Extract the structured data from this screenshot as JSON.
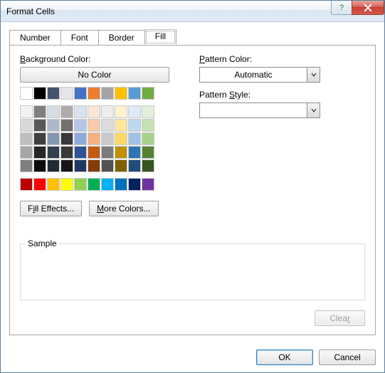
{
  "window": {
    "title": "Format Cells"
  },
  "tabs": [
    "Number",
    "Font",
    "Border",
    "Fill"
  ],
  "active_tab": "Fill",
  "labels": {
    "background_color": "Background Color:",
    "pattern_color": "Pattern Color:",
    "pattern_style": "Pattern Style:",
    "sample": "Sample"
  },
  "buttons": {
    "no_color": "No Color",
    "fill_effects_pre": "F",
    "fill_effects_ul": "i",
    "fill_effects_post": "ll Effects...",
    "more_colors_pre": "",
    "more_colors_ul": "M",
    "more_colors_post": "ore Colors...",
    "clear": "Clear",
    "ok": "OK",
    "cancel": "Cancel"
  },
  "pattern_color_value": "Automatic",
  "pattern_style_value": "",
  "theme_colors_row1": [
    "#FFFFFF",
    "#000000",
    "#44546A",
    "#E7E6E6",
    "#4472C4",
    "#ED7D31",
    "#A5A5A5",
    "#FFC000",
    "#5B9BD5",
    "#70AD47"
  ],
  "theme_shades": [
    [
      "#F2F2F2",
      "#808080",
      "#D6DCE4",
      "#AEABAB",
      "#D9E2F3",
      "#FCE4D6",
      "#EDEDED",
      "#FFF2CC",
      "#DEEBF6",
      "#E2EFDA"
    ],
    [
      "#D9D9D9",
      "#595959",
      "#ADB9CA",
      "#757070",
      "#B4C6E7",
      "#F8CBAD",
      "#DBDBDB",
      "#FFE699",
      "#BDD7EE",
      "#C6E0B4"
    ],
    [
      "#BFBFBF",
      "#404040",
      "#8496B0",
      "#3A3838",
      "#8EAADB",
      "#F4B183",
      "#C9C9C9",
      "#FFD966",
      "#9CC3E6",
      "#A9D18E"
    ],
    [
      "#A6A6A6",
      "#262626",
      "#323F4F",
      "#3A3838",
      "#2F5496",
      "#C55A11",
      "#7B7B7B",
      "#BF9000",
      "#2E75B6",
      "#548235"
    ],
    [
      "#808080",
      "#0D0D0D",
      "#222A35",
      "#171616",
      "#1F3864",
      "#833C0B",
      "#525252",
      "#7F6000",
      "#1F4E79",
      "#375623"
    ]
  ],
  "standard_colors": [
    "#C00000",
    "#FF0000",
    "#FFC000",
    "#FFFF00",
    "#92D050",
    "#00B050",
    "#00B0F0",
    "#0070C0",
    "#002060",
    "#7030A0"
  ]
}
